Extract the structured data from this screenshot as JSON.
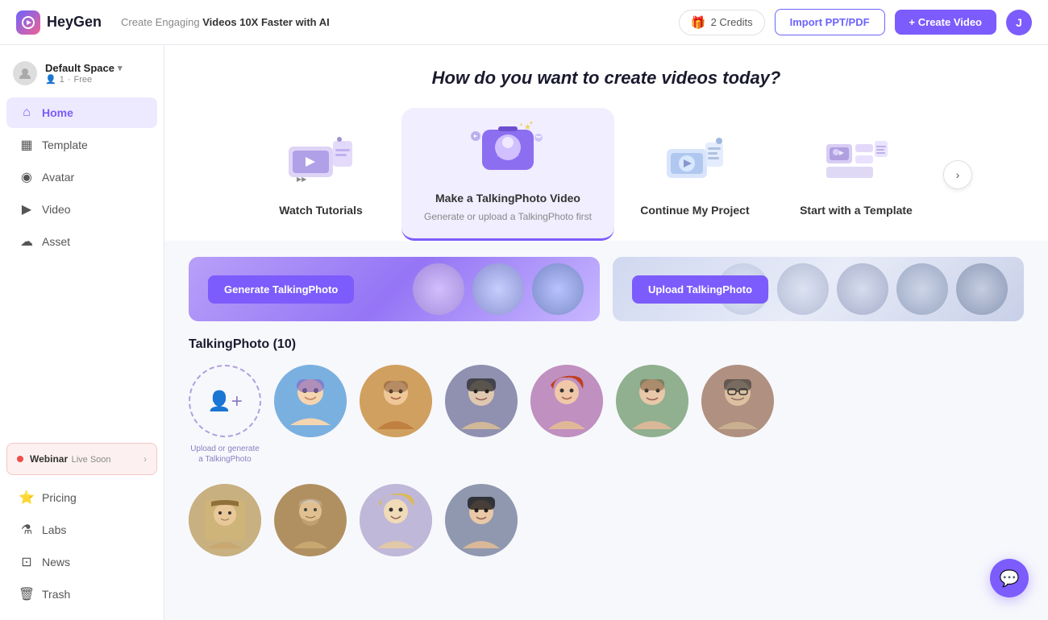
{
  "brand": {
    "name": "HeyGen",
    "tagline": "Create Engaging ",
    "tagline_bold": "Videos 10X Faster with AI"
  },
  "nav": {
    "credits_count": "2 Credits",
    "import_btn": "Import PPT/PDF",
    "create_btn": "+ Create Video",
    "user_initial": "J"
  },
  "sidebar": {
    "workspace_name": "Default Space",
    "workspace_users": "1",
    "workspace_plan": "Free",
    "items": [
      {
        "id": "home",
        "label": "Home",
        "icon": "home",
        "active": true
      },
      {
        "id": "template",
        "label": "Template",
        "icon": "template",
        "active": false
      },
      {
        "id": "avatar",
        "label": "Avatar",
        "icon": "avatar",
        "active": false
      },
      {
        "id": "video",
        "label": "Video",
        "icon": "video",
        "active": false
      },
      {
        "id": "asset",
        "label": "Asset",
        "icon": "asset",
        "active": false
      }
    ],
    "bottom_items": [
      {
        "id": "pricing",
        "label": "Pricing",
        "icon": "pricing"
      },
      {
        "id": "labs",
        "label": "Labs",
        "icon": "labs"
      },
      {
        "id": "news",
        "label": "News",
        "icon": "news"
      },
      {
        "id": "trash",
        "label": "Trash",
        "icon": "trash"
      }
    ],
    "webinar_label": "Webinar",
    "webinar_status": "Live Soon",
    "webinar_chevron": "›"
  },
  "hero": {
    "title": "How do you want to create videos today?",
    "cards": [
      {
        "id": "tutorials",
        "title": "Watch Tutorials",
        "subtitle": ""
      },
      {
        "id": "talking-photo",
        "title": "Make a TalkingPhoto Video",
        "subtitle": "Generate or upload a TalkingPhoto first"
      },
      {
        "id": "my-project",
        "title": "Continue My Project",
        "subtitle": ""
      },
      {
        "id": "template",
        "title": "Start with a Template",
        "subtitle": ""
      }
    ]
  },
  "talking_photo": {
    "section_title": "TalkingPhoto (10)",
    "generate_btn": "Generate TalkingPhoto",
    "upload_btn": "Upload TalkingPhoto",
    "upload_label": "Upload or generate a TalkingPhoto",
    "count": 10
  },
  "chat": {
    "icon": "💬"
  }
}
